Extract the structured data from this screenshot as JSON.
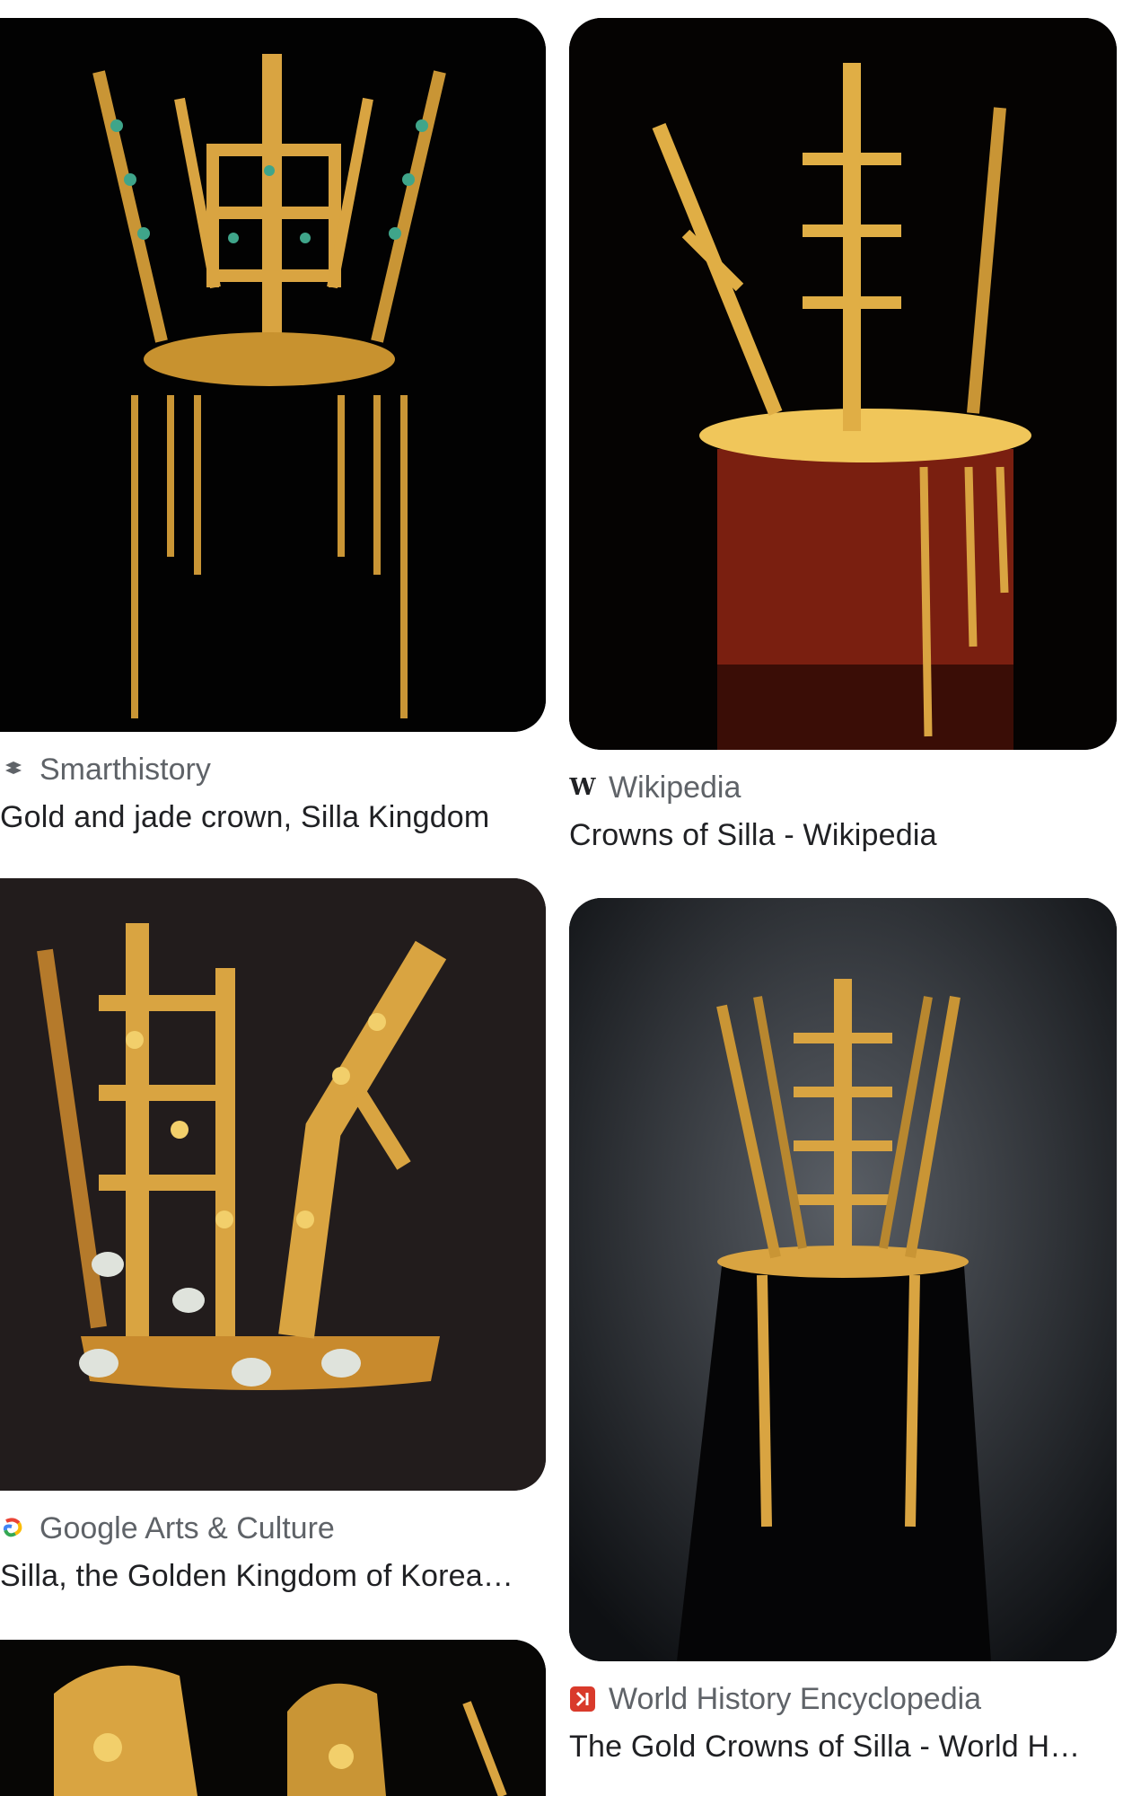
{
  "results": [
    {
      "source": "Smarthistory",
      "source_icon": "smarthistory-icon",
      "title": "Gold and jade crown, Silla Kingdom"
    },
    {
      "source": "Wikipedia",
      "source_icon": "wikipedia-icon",
      "title": "Crowns of Silla - Wikipedia"
    },
    {
      "source": "Google Arts & Culture",
      "source_icon": "google-arts-culture-icon",
      "title": "Silla, the Golden Kingdom of Korea…"
    },
    {
      "source": "World History Encyclopedia",
      "source_icon": "world-history-encyclopedia-icon",
      "title": "The Gold Crowns of Silla - World H…"
    }
  ],
  "colors": {
    "gold": "#d9a441",
    "source_text": "#5f6368",
    "title_text": "#202124",
    "whe_red": "#d93a2b"
  }
}
